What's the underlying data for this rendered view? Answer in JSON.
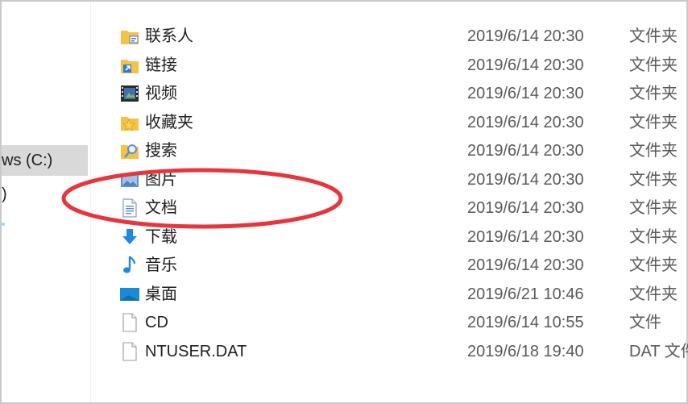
{
  "nav": {
    "drive_label": "ws (C:)",
    "other_label": ")"
  },
  "files": [
    {
      "name": "联系人",
      "date": "2019/6/14 20:30",
      "type": "文件夹",
      "icon": "contacts-folder-icon"
    },
    {
      "name": "链接",
      "date": "2019/6/14 20:30",
      "type": "文件夹",
      "icon": "links-folder-icon"
    },
    {
      "name": "视频",
      "date": "2019/6/14 20:30",
      "type": "文件夹",
      "icon": "videos-folder-icon"
    },
    {
      "name": "收藏夹",
      "date": "2019/6/14 20:30",
      "type": "文件夹",
      "icon": "favorites-folder-icon"
    },
    {
      "name": "搜索",
      "date": "2019/6/14 20:30",
      "type": "文件夹",
      "icon": "searches-folder-icon"
    },
    {
      "name": "图片",
      "date": "2019/6/14 20:30",
      "type": "文件夹",
      "icon": "pictures-folder-icon"
    },
    {
      "name": "文档",
      "date": "2019/6/14 20:30",
      "type": "文件夹",
      "icon": "documents-folder-icon"
    },
    {
      "name": "下载",
      "date": "2019/6/14 20:30",
      "type": "文件夹",
      "icon": "downloads-folder-icon"
    },
    {
      "name": "音乐",
      "date": "2019/6/14 20:30",
      "type": "文件夹",
      "icon": "music-folder-icon"
    },
    {
      "name": "桌面",
      "date": "2019/6/21 10:46",
      "type": "文件夹",
      "icon": "desktop-folder-icon"
    },
    {
      "name": "CD",
      "date": "2019/6/14 10:55",
      "type": "文件",
      "icon": "file-icon"
    },
    {
      "name": "NTUSER.DAT",
      "date": "2019/6/18 19:40",
      "type": "DAT 文件",
      "icon": "file-icon"
    }
  ],
  "colors": {
    "annotation": "#e8343c",
    "selection": "#d9d9d9",
    "folder": "#f4c244",
    "accent_blue": "#1e88e5"
  }
}
